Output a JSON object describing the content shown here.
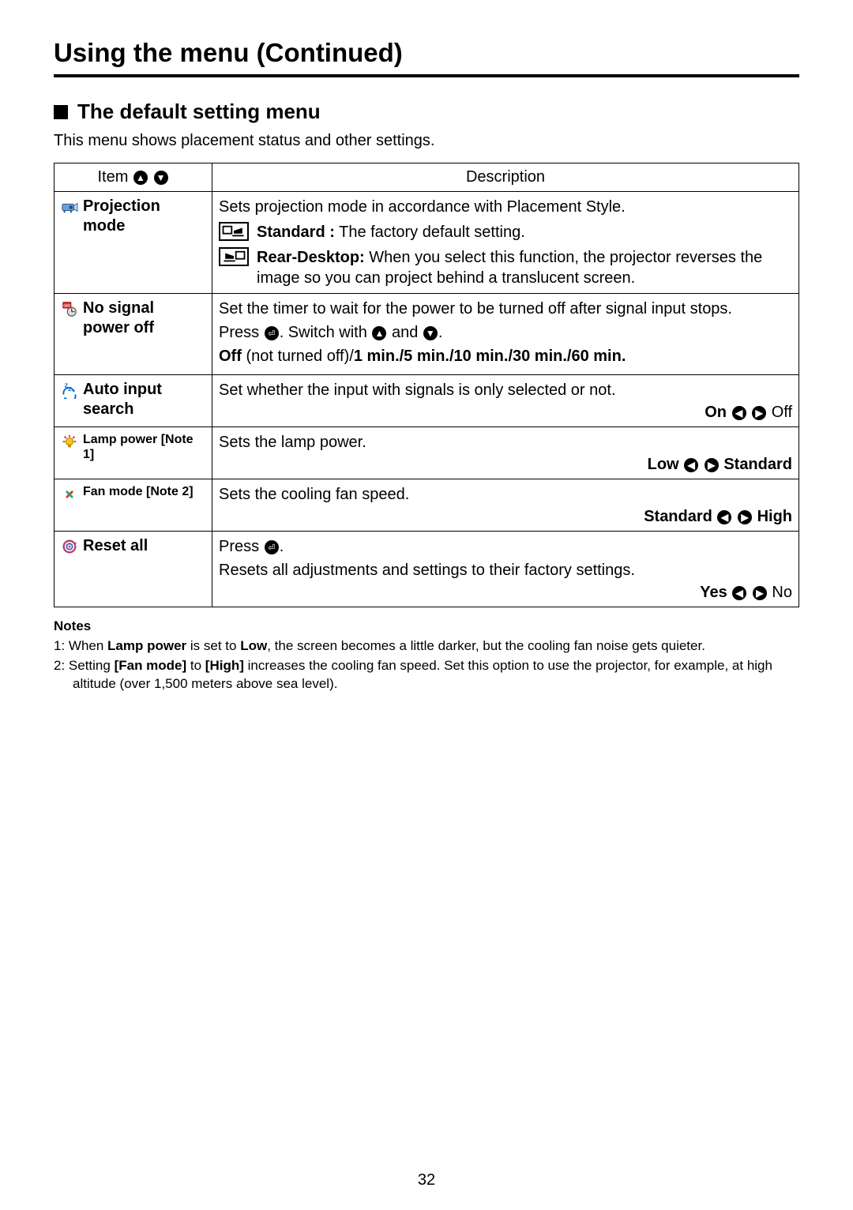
{
  "page_title": "Using the menu (Continued)",
  "section_title": "The default setting menu",
  "intro": "This menu shows placement status and other settings.",
  "table_headers": {
    "item": "Item",
    "description": "Description"
  },
  "rows": {
    "projection_mode": {
      "label_line1": "Projection",
      "label_line2": "mode",
      "desc_intro": "Sets projection mode in accordance with Placement Style.",
      "standard_label": "Standard :",
      "standard_text": " The factory default setting.",
      "rear_label": "Rear-Desktop:",
      "rear_text": " When you select this function, the projector reverses the image so you can project behind a translucent screen."
    },
    "no_signal": {
      "label_line1": "No signal",
      "label_line2": "power off",
      "desc_line1": "Set the timer to wait for the power to be turned off after signal input stops.",
      "desc_line2a": "Press ",
      "desc_line2b": ". Switch with ",
      "desc_line2c": " and ",
      "desc_line2d": ".",
      "desc_line3_bold": "Off",
      "desc_line3_rest": " (not turned off)/",
      "desc_line3_bold2": "1 min./5 min./10 min./30 min./60 min."
    },
    "auto_input": {
      "label_line1": "Auto input",
      "label_line2": "search",
      "desc": "Set whether the input with signals is only selected or not.",
      "optA": "On",
      "optB": "Off"
    },
    "lamp_power": {
      "label": "Lamp power",
      "note_ref": "[Note 1]",
      "desc": "Sets the lamp power.",
      "optA": "Low",
      "optB": "Standard"
    },
    "fan_mode": {
      "label": "Fan mode",
      "note_ref": "[Note 2]",
      "desc": "Sets the cooling fan speed.",
      "optA": "Standard",
      "optB": "High"
    },
    "reset_all": {
      "label": "Reset all",
      "desc_a": "Press ",
      "desc_b": ".",
      "desc_c": "Resets all adjustments and settings to their factory settings.",
      "optA": "Yes",
      "optB": "No"
    }
  },
  "notes": {
    "heading": "Notes",
    "n1_prefix": "1: When ",
    "n1_b1": "Lamp power",
    "n1_mid": " is set to ",
    "n1_b2": "Low",
    "n1_rest": ", the screen becomes a little darker, but the cooling fan noise gets quieter.",
    "n2_prefix": "2: Setting ",
    "n2_b1": "[Fan mode]",
    "n2_mid": " to ",
    "n2_b2": "[High]",
    "n2_rest": " increases the cooling fan speed. Set this option to use the projector, for example, at high altitude (over 1,500 meters above sea level)."
  },
  "page_number": "32"
}
